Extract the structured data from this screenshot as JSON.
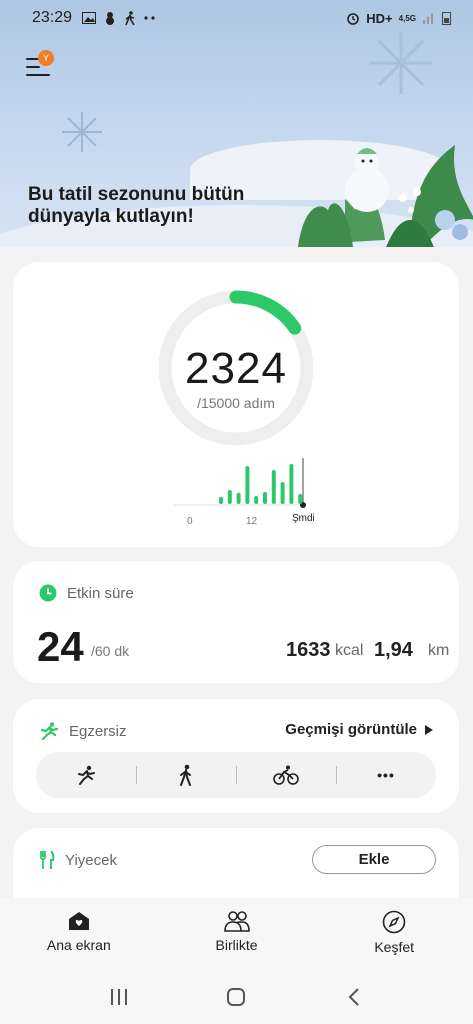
{
  "status_bar": {
    "time": "23:29",
    "network": "HD+",
    "network_type": "4,5G"
  },
  "banner": {
    "menu_badge": "Y",
    "headline_line1": "Bu tatil sezonunu bütün",
    "headline_line2": "dünyayla kutlayın!"
  },
  "steps": {
    "count": "2324",
    "goal_text": "/15000 adım",
    "progress_fraction": 0.155,
    "axis_start": "0",
    "axis_mid": "12",
    "axis_now": "Şmdi",
    "hourly_relative": [
      0.18,
      0.35,
      0.28,
      0.95,
      0.2,
      0.3,
      0.85,
      0.55,
      1.0,
      0.25
    ]
  },
  "active_time": {
    "title": "Etkin süre",
    "minutes": "24",
    "minutes_goal": "/60 dk",
    "kcal_value": "1633",
    "kcal_unit": "kcal",
    "km_value": "1,94",
    "km_unit": "km"
  },
  "exercise": {
    "title": "Egzersiz",
    "history_link": "Geçmişi görüntüle",
    "more_label": "•••"
  },
  "food": {
    "title": "Yiyecek",
    "add_label": "Ekle"
  },
  "bottom_nav": {
    "home": "Ana ekran",
    "together": "Birlikte",
    "discover": "Keşfet"
  },
  "colors": {
    "accent_green": "#2dc86a",
    "ring_track": "#eeeeee"
  }
}
